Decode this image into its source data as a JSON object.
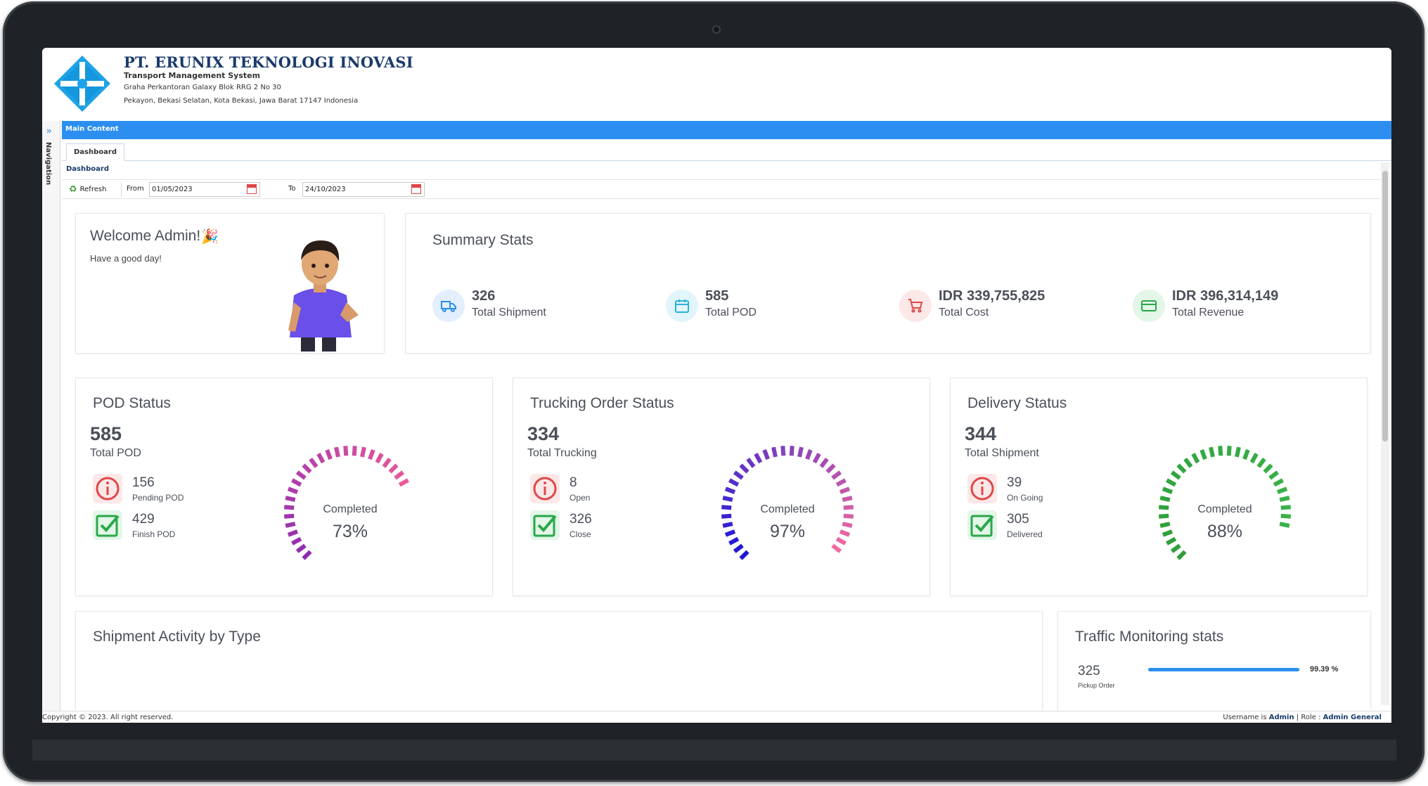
{
  "header": {
    "company": "PT. ERUNIX TEKNOLOGI INOVASI",
    "subtitle": "Transport Management System",
    "address_line1": "Graha Perkantoran Galaxy Blok RRG 2 No 30",
    "address_line2": "Pekayon, Bekasi Selatan, Kota Bekasi, Jawa Barat 17147 Indonesia"
  },
  "nav": {
    "label": "Navigation",
    "toggle_icon": "double-chevron-right-icon"
  },
  "main_bar": {
    "title": "Main Content"
  },
  "tabs": [
    {
      "label": "Dashboard"
    }
  ],
  "page": {
    "label": "Dashboard"
  },
  "toolbar": {
    "refresh_label": "Refresh",
    "from_label": "From",
    "from_value": "01/05/2023",
    "to_label": "To",
    "to_value": "24/10/2023"
  },
  "welcome": {
    "title": "Welcome Admin!",
    "greeting": "Have a good day!"
  },
  "summary": {
    "title": "Summary Stats",
    "stats": [
      {
        "value": "326",
        "label": "Total Shipment",
        "icon": "truck-icon",
        "color": "#2b8ef0",
        "bg": "#e3effd"
      },
      {
        "value": "585",
        "label": "Total POD",
        "icon": "calendar-icon",
        "color": "#2bb3d6",
        "bg": "#e1f5fa"
      },
      {
        "value": "IDR 339,755,825",
        "label": "Total Cost",
        "icon": "cart-icon",
        "color": "#e04848",
        "bg": "#fde8e8"
      },
      {
        "value": "IDR 396,314,149",
        "label": "Total Revenue",
        "icon": "credit-card-icon",
        "color": "#2aa84a",
        "bg": "#e3f6e8"
      }
    ]
  },
  "pod_status": {
    "title": "POD Status",
    "total": "585",
    "total_label": "Total POD",
    "rows": [
      {
        "value": "156",
        "label": "Pending POD",
        "icon": "alert-circle-icon"
      },
      {
        "value": "429",
        "label": "Finish POD",
        "icon": "check-square-icon"
      }
    ],
    "gauge_title": "Completed",
    "gauge_value": "73%",
    "gauge_fraction": 0.73,
    "colors": [
      "#8e2bb0",
      "#e85a9a"
    ]
  },
  "trucking_status": {
    "title": "Trucking Order Status",
    "total": "334",
    "total_label": "Total Trucking",
    "rows": [
      {
        "value": "8",
        "label": "Open",
        "icon": "alert-circle-icon"
      },
      {
        "value": "326",
        "label": "Close",
        "icon": "check-square-icon"
      }
    ],
    "gauge_title": "Completed",
    "gauge_value": "97%",
    "gauge_fraction": 0.97,
    "colors": [
      "#1a16d8",
      "#f06aa0"
    ]
  },
  "delivery_status": {
    "title": "Delivery Status",
    "total": "344",
    "total_label": "Total Shipment",
    "rows": [
      {
        "value": "39",
        "label": "On Going",
        "icon": "alert-circle-icon"
      },
      {
        "value": "305",
        "label": "Delivered",
        "icon": "check-square-icon"
      }
    ],
    "gauge_title": "Completed",
    "gauge_value": "88%",
    "gauge_fraction": 0.88,
    "colors": [
      "#2e9e3a",
      "#3bb34a"
    ]
  },
  "activity": {
    "title": "Shipment Activity by Type"
  },
  "traffic": {
    "title": "Traffic Monitoring stats",
    "value": "325",
    "label": "Pickup Order",
    "percent": "99.39 %",
    "fraction": 0.9939
  },
  "footer": {
    "copyright": "Copyright © 2023. All right reserved.",
    "username_prefix": "Username is",
    "username": "Admin",
    "role_prefix": "| Role :",
    "role": "Admin General"
  }
}
